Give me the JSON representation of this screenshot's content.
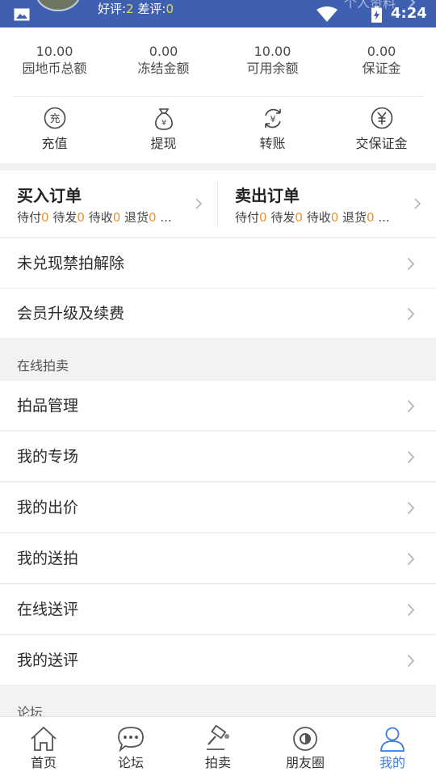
{
  "status_bar": {
    "rating_good_label": "好评:",
    "rating_good_value": "2",
    "rating_bad_label": "差评:",
    "rating_bad_value": "0",
    "profile_link": "个人资料",
    "time": "4:24"
  },
  "stats": [
    {
      "value": "10.00",
      "label": "园地币总额"
    },
    {
      "value": "0.00",
      "label": "冻结金额"
    },
    {
      "value": "10.00",
      "label": "可用余额"
    },
    {
      "value": "0.00",
      "label": "保证金"
    }
  ],
  "actions": [
    {
      "label": "充值",
      "icon": "recharge-icon"
    },
    {
      "label": "提现",
      "icon": "money-bag-icon"
    },
    {
      "label": "转账",
      "icon": "transfer-icon"
    },
    {
      "label": "交保证金",
      "icon": "yuan-icon"
    }
  ],
  "orders": {
    "buy": {
      "title": "买入订单",
      "statuses": [
        {
          "label": "待付",
          "count": "0"
        },
        {
          "label": "待发",
          "count": "0"
        },
        {
          "label": "待收",
          "count": "0"
        },
        {
          "label": "退货",
          "count": "0"
        }
      ],
      "ellipsis": "..."
    },
    "sell": {
      "title": "卖出订单",
      "statuses": [
        {
          "label": "待付",
          "count": "0"
        },
        {
          "label": "待发",
          "count": "0"
        },
        {
          "label": "待收",
          "count": "0"
        },
        {
          "label": "退货",
          "count": "0"
        }
      ],
      "ellipsis": "..."
    }
  },
  "menu": {
    "unredeemed": "未兑现禁拍解除",
    "membership": "会员升级及续费"
  },
  "auction_section": {
    "title": "在线拍卖",
    "items": [
      "拍品管理",
      "我的专场",
      "我的出价",
      "我的送拍",
      "在线送评",
      "我的送评"
    ]
  },
  "forum_section": {
    "title": "论坛"
  },
  "bottom_nav": [
    {
      "label": "首页",
      "icon": "home-icon"
    },
    {
      "label": "论坛",
      "icon": "chat-bubble-icon"
    },
    {
      "label": "拍卖",
      "icon": "auction-hammer-icon"
    },
    {
      "label": "朋友圈",
      "icon": "moments-icon"
    },
    {
      "label": "我的",
      "icon": "user-icon",
      "active": true
    }
  ],
  "colors": {
    "header": "#3f5fb0",
    "accent": "#3b7ddd",
    "count": "#e8932e",
    "rating": "#e9d84b"
  }
}
